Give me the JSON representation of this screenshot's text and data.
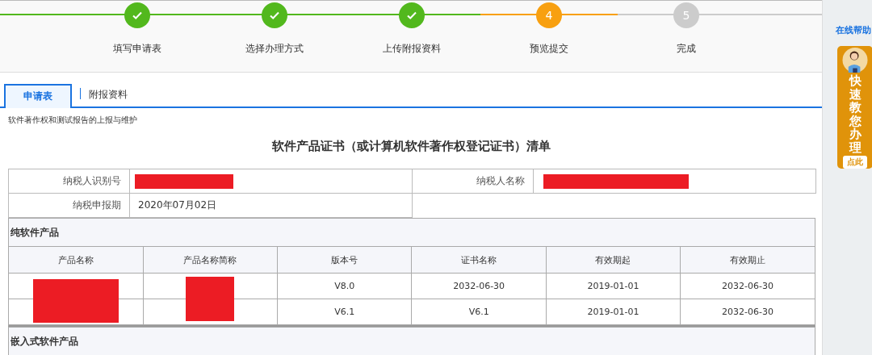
{
  "steps": [
    {
      "label": "填写申请表",
      "completed": true,
      "current": false
    },
    {
      "label": "选择办理方式",
      "completed": true,
      "current": false
    },
    {
      "label": "上传附报资料",
      "completed": true,
      "current": false
    },
    {
      "number": "4",
      "label": "预览提交",
      "completed": false,
      "current": true
    },
    {
      "number": "5",
      "label": "完成",
      "completed": false,
      "current": false
    }
  ],
  "tabs": [
    {
      "label": "申请表",
      "selected": true
    },
    {
      "label": "附报资料",
      "selected": false
    }
  ],
  "subtitle": "软件著作权和测试报告的上报与维护",
  "title": "软件产品证书（或计算机软件著作权登记证书）清单",
  "taxpayer_info": [
    {
      "label": "纳税人识别号",
      "redacted": true
    },
    {
      "label": "纳税人名称",
      "redacted": true
    },
    {
      "label": "纳税申报期",
      "value": "2020年07月02日"
    }
  ],
  "sections": [
    {
      "title": "纯软件产品",
      "columns": [
        "产品名称",
        "产品名称简称",
        "版本号",
        "证书名称",
        "有效期起",
        "有效期止"
      ],
      "rows": [
        [
          {
            "redacted": true
          },
          {
            "redacted": true
          },
          {
            "text": "V8.0"
          },
          {
            "text": "2032-06-30"
          },
          {
            "text": "2019-01-01"
          },
          {
            "text": "2032-06-30"
          }
        ],
        [
          {
            "redacted": true
          },
          {
            "redacted": true
          },
          {
            "text": "V6.1"
          },
          {
            "text": "V6.1"
          },
          {
            "text": "2019-01-01"
          },
          {
            "text": "2032-06-30"
          }
        ]
      ]
    },
    {
      "title": "嵌入式软件产品"
    }
  ],
  "sidebar": {
    "help_link": "在线帮助",
    "assistant": {
      "title": "快速教您办理",
      "button": "点此"
    }
  }
}
